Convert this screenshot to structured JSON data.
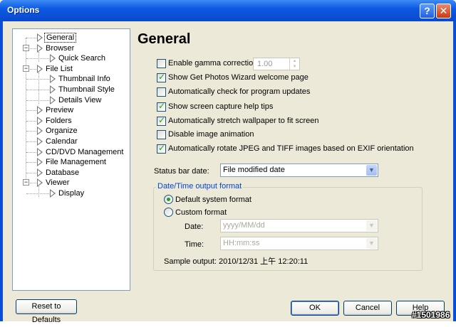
{
  "window": {
    "title": "Options",
    "help_glyph": "?",
    "close_glyph": "✕"
  },
  "tree": {
    "items": [
      {
        "label": "General",
        "selected": true
      },
      {
        "label": "Browser"
      },
      {
        "label": "Quick Search"
      },
      {
        "label": "File List"
      },
      {
        "label": "Thumbnail Info"
      },
      {
        "label": "Thumbnail Style"
      },
      {
        "label": "Details View"
      },
      {
        "label": "Preview"
      },
      {
        "label": "Folders"
      },
      {
        "label": "Organize"
      },
      {
        "label": "Calendar"
      },
      {
        "label": "CD/DVD Management"
      },
      {
        "label": "File Management"
      },
      {
        "label": "Database"
      },
      {
        "label": "Viewer"
      },
      {
        "label": "Display"
      }
    ],
    "collapse_glyph": "−"
  },
  "main": {
    "page_title": "General",
    "options": [
      {
        "label": "Enable gamma correction:",
        "checked": false
      },
      {
        "label": "Show Get Photos Wizard welcome page",
        "checked": true
      },
      {
        "label": "Automatically check for program updates",
        "checked": false
      },
      {
        "label": "Show screen capture help tips",
        "checked": true
      },
      {
        "label": "Automatically stretch wallpaper to fit screen",
        "checked": true
      },
      {
        "label": "Disable image animation",
        "checked": false
      },
      {
        "label": "Automatically rotate JPEG and TIFF images based on EXIF orientation",
        "checked": true
      }
    ],
    "check_glyph": "✓",
    "gamma_value": "1.00",
    "status_bar_label": "Status bar date:",
    "status_bar_value": "File modified date",
    "datetime_group": {
      "legend": "Date/Time output format",
      "default_label": "Default system format",
      "custom_label": "Custom format",
      "selected": "default",
      "date_label": "Date:",
      "date_value": "yyyy/MM/dd",
      "time_label": "Time:",
      "time_value": "HH:mm:ss",
      "sample_output": "Sample output: 2010/12/31 上午 12:20:11"
    }
  },
  "buttons": {
    "reset": "Reset to Defaults",
    "ok": "OK",
    "cancel": "Cancel",
    "help": "Help"
  },
  "watermark": "#1501986",
  "colors": {
    "titlebar": "#0a4fd6",
    "dialog_bg": "#ece9d8",
    "check_green": "#21a121",
    "group_legend": "#0046d5"
  }
}
